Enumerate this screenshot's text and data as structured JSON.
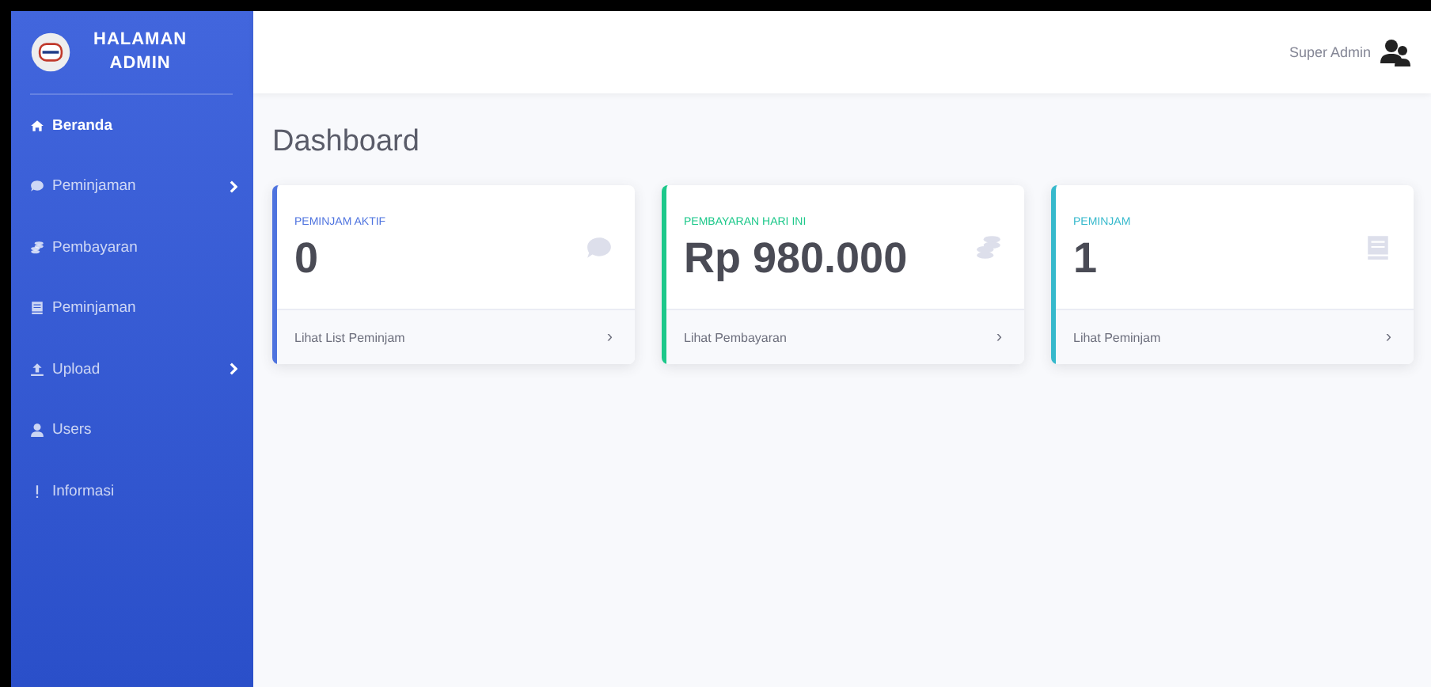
{
  "brand": {
    "line_1": "HALAMAN",
    "line_2": "ADMIN"
  },
  "sidebar": {
    "items": [
      {
        "label": "Beranda",
        "kind": "home",
        "selected": true,
        "has_submenu": false
      },
      {
        "label": "Peminjaman",
        "kind": "chat",
        "selected": false,
        "has_submenu": true
      },
      {
        "label": "Pembayaran",
        "kind": "stack",
        "selected": false,
        "has_submenu": false
      },
      {
        "label": "Peminjaman",
        "kind": "book",
        "selected": false,
        "has_submenu": false
      },
      {
        "label": "Upload",
        "kind": "upload",
        "selected": false,
        "has_submenu": true
      },
      {
        "label": "Users",
        "kind": "user",
        "selected": false,
        "has_submenu": false
      },
      {
        "label": "Informasi",
        "kind": "info",
        "selected": false,
        "has_submenu": false
      }
    ]
  },
  "topbar": {
    "user_name": "Super Admin"
  },
  "page_title": "Dashboard",
  "cards": [
    {
      "title": "PEMINJAM AKTIF",
      "value": "0",
      "kind": "chat",
      "color": "#4e73df",
      "link": "Lihat List Peminjam",
      "arrow": "›"
    },
    {
      "title": "PEMBAYARAN HARI INI",
      "value": "Rp 980.000",
      "kind": "coins",
      "color": "#1cc88a",
      "link": "Lihat Pembayaran",
      "arrow": "›"
    },
    {
      "title": "PEMINJAM",
      "value": "1",
      "kind": "book",
      "color": "#36b9cc",
      "link": "Lihat Peminjam",
      "arrow": "›"
    }
  ]
}
